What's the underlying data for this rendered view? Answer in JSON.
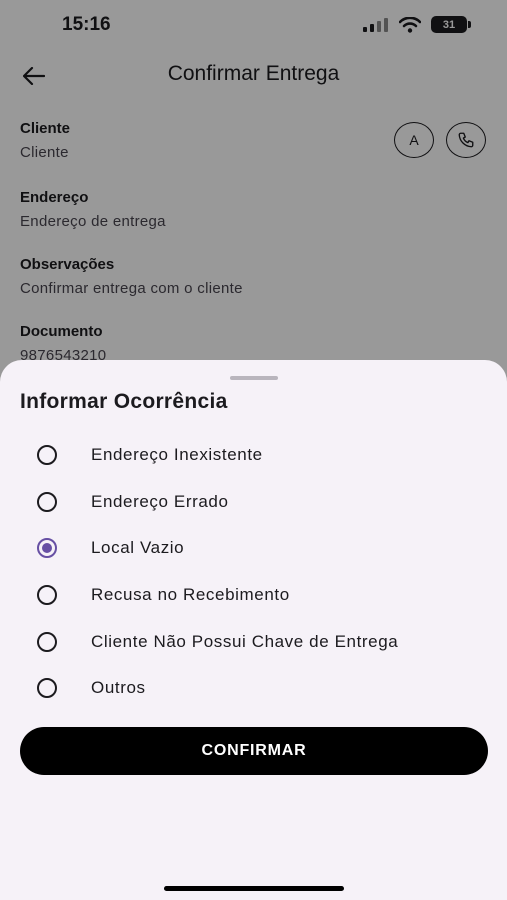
{
  "status_bar": {
    "time": "15:16",
    "battery": "31"
  },
  "header": {
    "title": "Confirmar Entrega"
  },
  "details": [
    {
      "label": "Cliente",
      "value": "Cliente"
    },
    {
      "label": "Endereço",
      "value": "Endereço de entrega"
    },
    {
      "label": "Observações",
      "value": "Confirmar entrega com o cliente"
    },
    {
      "label": "Documento",
      "value": "9876543210"
    }
  ],
  "actions": {
    "navigate_letter": "A"
  },
  "sheet": {
    "title": "Informar Ocorrência",
    "options": [
      {
        "label": "Endereço Inexistente",
        "selected": false
      },
      {
        "label": "Endereço Errado",
        "selected": false
      },
      {
        "label": "Local Vazio",
        "selected": true
      },
      {
        "label": "Recusa no Recebimento",
        "selected": false
      },
      {
        "label": "Cliente Não Possui Chave de Entrega",
        "selected": false
      },
      {
        "label": "Outros",
        "selected": false
      }
    ],
    "confirm_label": "CONFIRMAR"
  },
  "colors": {
    "accent": "#6750a4",
    "sheet_bg": "#f6f2f8",
    "button_bg": "#000000"
  }
}
